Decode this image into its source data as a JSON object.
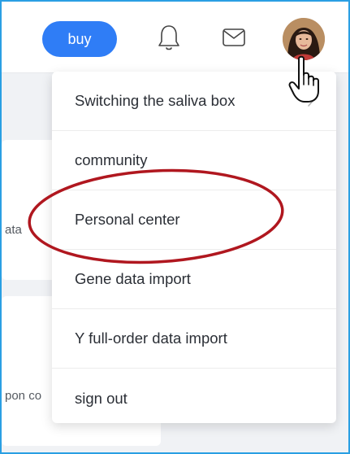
{
  "header": {
    "buy_label": "buy",
    "icons": [
      "bell-icon",
      "mail-icon",
      "avatar"
    ]
  },
  "background": {
    "snippet_1": "ata",
    "snippet_2": "pon co"
  },
  "menu": {
    "items": [
      {
        "label": "Switching the saliva box",
        "has_chevron": true
      },
      {
        "label": "community"
      },
      {
        "label": "Personal center",
        "highlighted": true
      },
      {
        "label": "Gene data import"
      },
      {
        "label": "Y full-order data import"
      },
      {
        "label": "sign out"
      }
    ]
  },
  "colors": {
    "accent": "#2f7df6",
    "frame_border": "#2a9fe3",
    "highlight_ring": "#b0171f"
  }
}
